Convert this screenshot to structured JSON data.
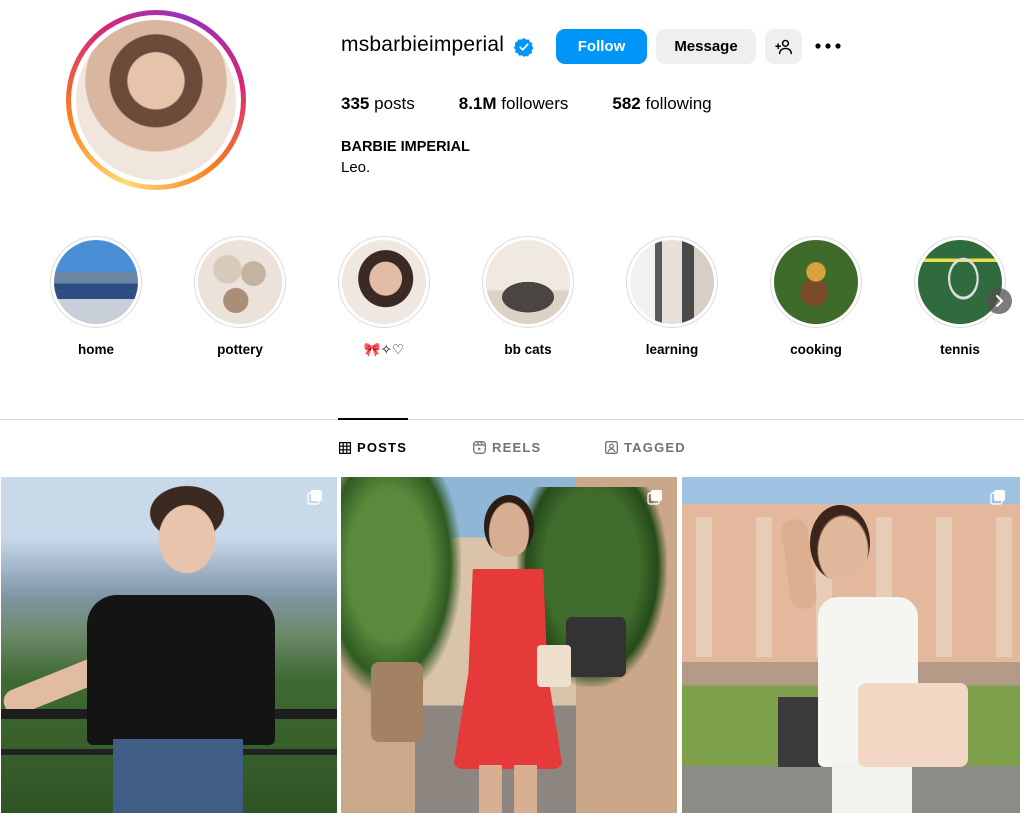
{
  "profile": {
    "username": "msbarbieimperial",
    "verified": true,
    "follow_label": "Follow",
    "message_label": "Message",
    "posts_count": "335",
    "posts_label": "posts",
    "followers_count": "8.1M",
    "followers_label": "followers",
    "following_count": "582",
    "following_label": "following",
    "full_name": "BARBIE IMPERIAL",
    "bio": "Leo."
  },
  "highlights": [
    {
      "label": "home"
    },
    {
      "label": "pottery"
    },
    {
      "label": "🎀✧♡"
    },
    {
      "label": "bb cats"
    },
    {
      "label": "learning"
    },
    {
      "label": "cooking"
    },
    {
      "label": "tennis"
    }
  ],
  "tabs": [
    {
      "label": "POSTS",
      "icon": "grid-icon",
      "active": true
    },
    {
      "label": "REELS",
      "icon": "reels-icon",
      "active": false
    },
    {
      "label": "TAGGED",
      "icon": "tagged-icon",
      "active": false
    }
  ],
  "colors": {
    "accent_blue": "#0095f6",
    "button_gray": "#efefef",
    "divider": "#dbdbdb",
    "tab_inactive": "#737373"
  },
  "posts": [
    {
      "icon": "multi-photo-icon"
    },
    {
      "icon": "multi-photo-icon"
    },
    {
      "icon": "multi-photo-icon"
    }
  ]
}
